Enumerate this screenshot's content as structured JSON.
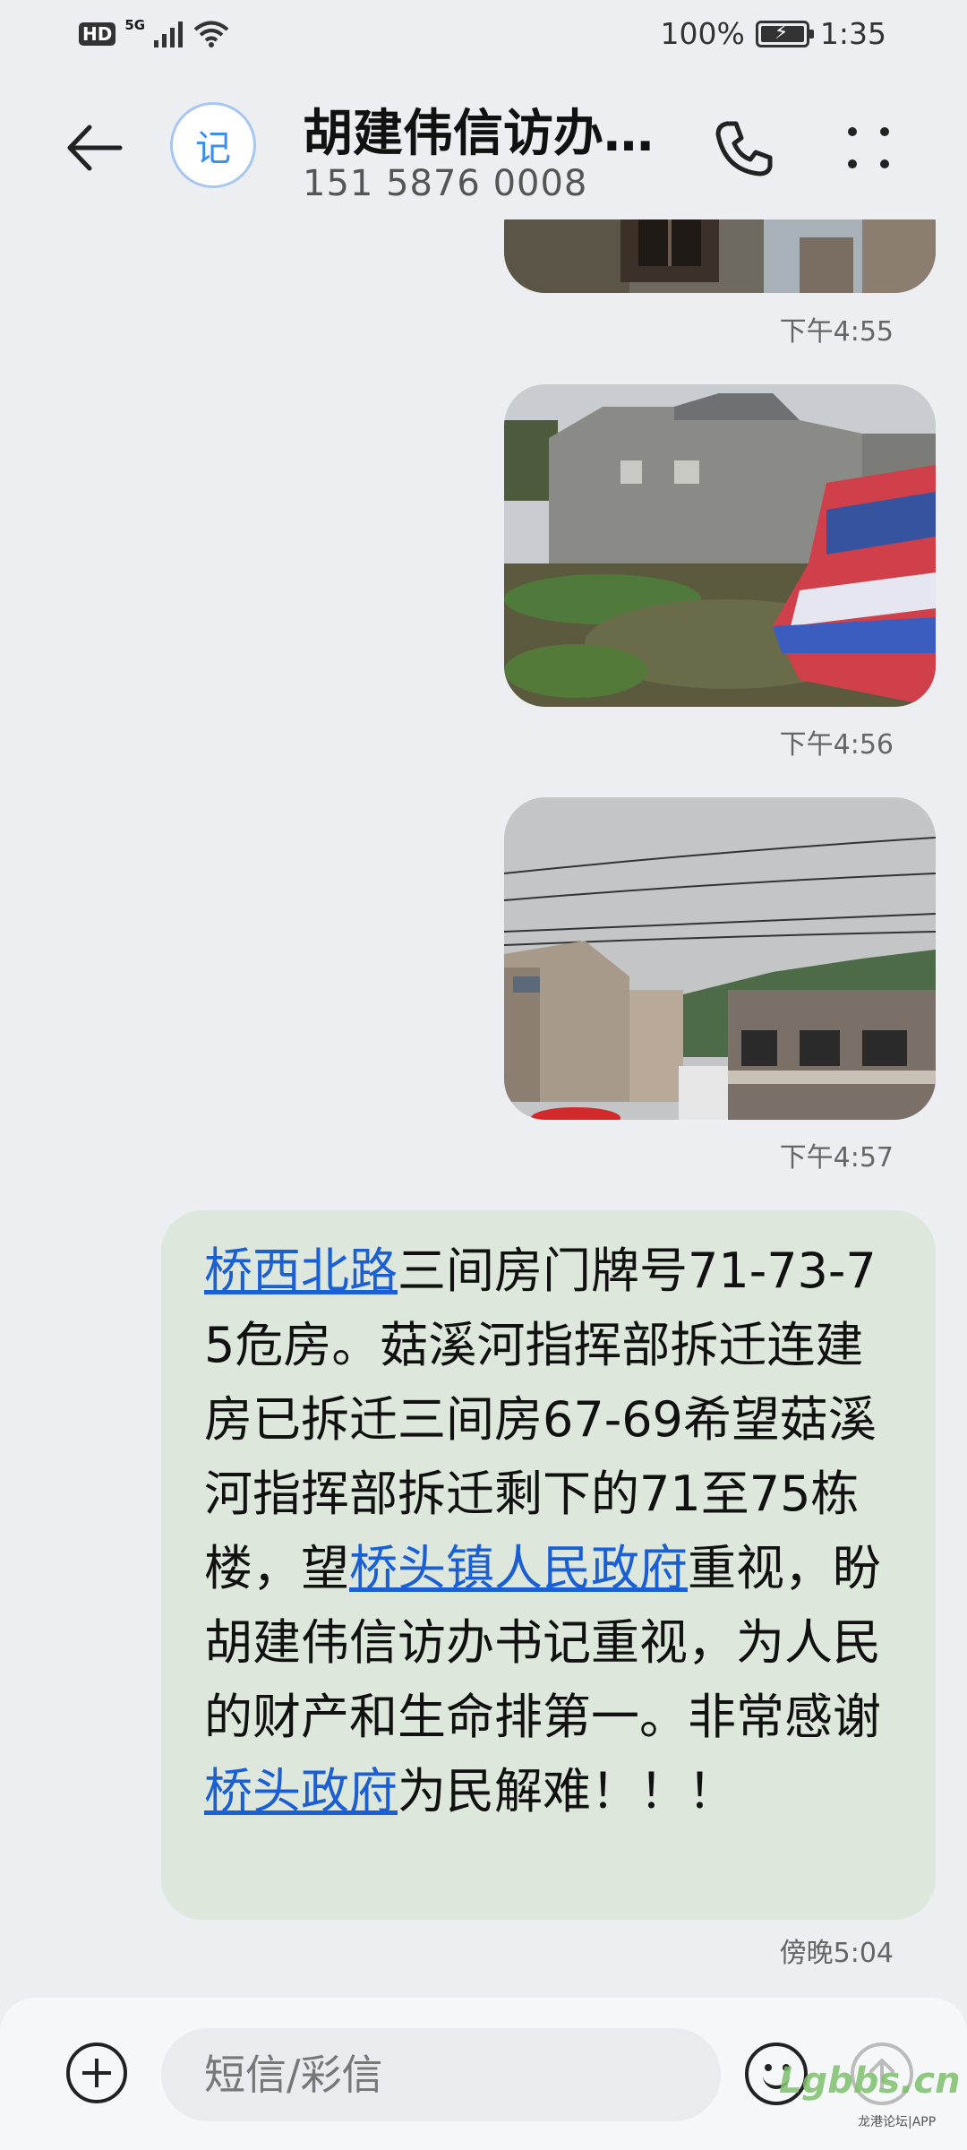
{
  "status_bar": {
    "network_badge": "HD",
    "network_type": "5G",
    "battery": "100%",
    "battery_level": 1.0,
    "time": "1:35"
  },
  "header": {
    "avatar_char": "记",
    "contact_name": "胡建伟信访办…",
    "contact_number": "151 5876 0008"
  },
  "messages": {
    "images": [
      {
        "time": "下午4:55"
      },
      {
        "time": "下午4:56"
      },
      {
        "time": "下午4:57"
      }
    ],
    "text_message": {
      "seg1_link": "桥西北路",
      "seg2": "三间房门牌号71-73-75危房。菇溪河指挥部拆迁连建房已拆迁三间房67-69希望菇溪河指挥部拆迁剩下的71至75栋楼，望",
      "seg3_link": "桥头镇人民政府",
      "seg4": "重视，盼胡建伟信访办书记重视，为人民的财产和生命排第一。非常感谢",
      "seg5_link": "桥头政府",
      "seg6": "为民解难！！！",
      "time": "傍晚5:04"
    }
  },
  "input_bar": {
    "placeholder": "短信/彩信"
  },
  "watermark": {
    "logo": "Lgbbs.cn",
    "sub": "龙港论坛|APP"
  },
  "colors": {
    "background": "#eceef1",
    "bubble": "#dde7dc",
    "link": "#1a5fd6",
    "avatar_accent": "#3b8ef0"
  }
}
